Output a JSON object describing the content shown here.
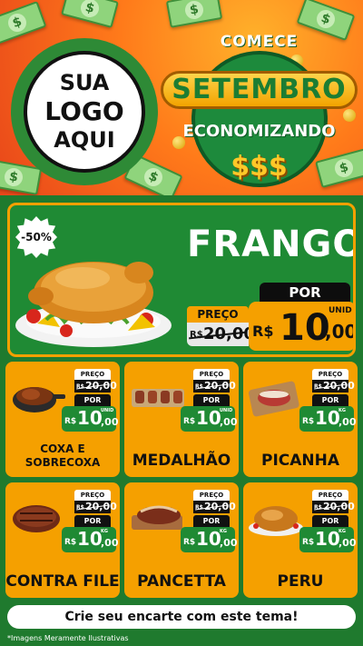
{
  "header": {
    "logo_lines": [
      "SUA",
      "LOGO",
      "AQUI"
    ],
    "promo_top": "COMECE",
    "promo_main": "SETEMBRO",
    "promo_sub": "ECONOMIZANDO",
    "promo_symbols": "$$$"
  },
  "featured": {
    "badge": "-50%",
    "title": "FRANGO",
    "preco_label": "PREÇO",
    "old_currency": "R$",
    "old_price": "20,00",
    "por_label": "POR",
    "currency": "R$",
    "price_int": "10",
    "price_dec": ",00",
    "unit": "UNID"
  },
  "products": [
    {
      "name_lines": [
        "COXA E",
        "SOBRECOXA"
      ],
      "preco_label": "PREÇO",
      "old_currency": "R$",
      "old_price": "20,00",
      "por_label": "POR",
      "currency": "R$",
      "price_int": "10",
      "price_dec": ",00",
      "unit": "UNID"
    },
    {
      "name": "MEDALHÃO",
      "preco_label": "PREÇO",
      "old_currency": "R$",
      "old_price": "20,00",
      "por_label": "POR",
      "currency": "R$",
      "price_int": "10",
      "price_dec": ",00",
      "unit": "UNID"
    },
    {
      "name": "PICANHA",
      "preco_label": "PREÇO",
      "old_currency": "R$",
      "old_price": "20,00",
      "por_label": "POR",
      "currency": "R$",
      "price_int": "10",
      "price_dec": ",00",
      "unit": "KG"
    },
    {
      "name": "CONTRA FILE",
      "preco_label": "PREÇO",
      "old_currency": "R$",
      "old_price": "20,00",
      "por_label": "POR",
      "currency": "R$",
      "price_int": "10",
      "price_dec": ",00",
      "unit": "KG"
    },
    {
      "name": "PANCETTA",
      "preco_label": "PREÇO",
      "old_currency": "R$",
      "old_price": "20,00",
      "por_label": "POR",
      "currency": "R$",
      "price_int": "10",
      "price_dec": ",00",
      "unit": "KG"
    },
    {
      "name": "PERU",
      "preco_label": "PREÇO",
      "old_currency": "R$",
      "old_price": "20,00",
      "por_label": "POR",
      "currency": "R$",
      "price_int": "10",
      "price_dec": ",00",
      "unit": "KG"
    }
  ],
  "footer": {
    "cta": "Crie seu encarte com este tema!",
    "disclaimer": "*Imagens Meramente Ilustrativas"
  },
  "colors": {
    "green": "#1f8a34",
    "orange": "#f5a000",
    "header_red": "#e8461a"
  }
}
